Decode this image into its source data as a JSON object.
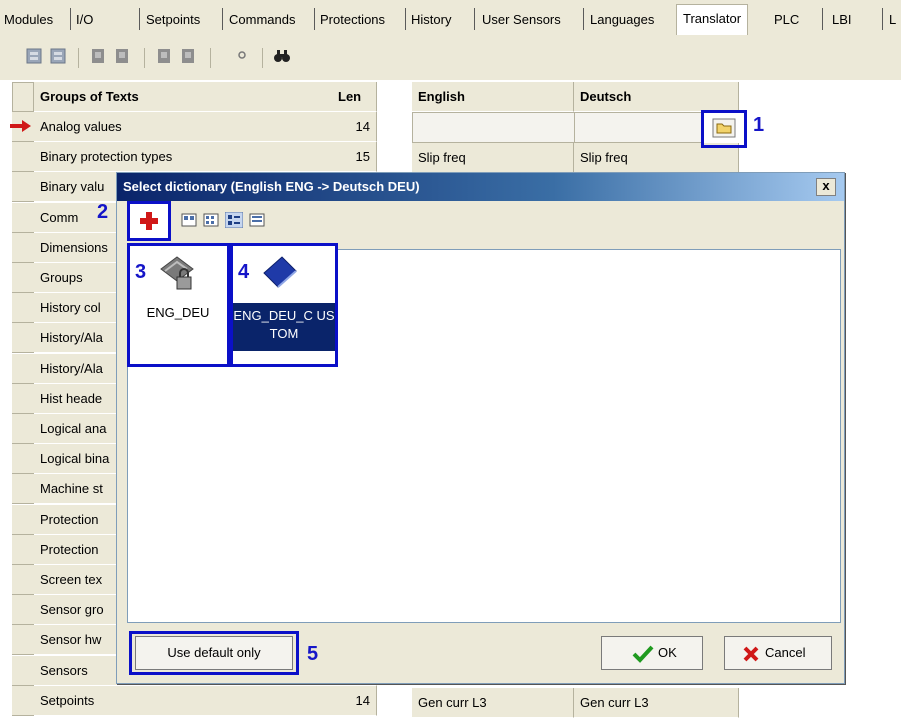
{
  "tabs": [
    {
      "label": "Modules"
    },
    {
      "label": "I/O"
    },
    {
      "label": "Setpoints"
    },
    {
      "label": "Commands"
    },
    {
      "label": "Protections"
    },
    {
      "label": "History"
    },
    {
      "label": "User Sensors"
    },
    {
      "label": "Languages"
    },
    {
      "label": "Translator"
    },
    {
      "label": "PLC"
    },
    {
      "label": "LBI"
    },
    {
      "label": "L"
    }
  ],
  "active_tab": "Translator",
  "groups_table": {
    "header_name": "Groups of Texts",
    "header_len": "Len",
    "rows": [
      {
        "name": "Analog values",
        "len": "14"
      },
      {
        "name": "Binary protection types",
        "len": "15"
      },
      {
        "name": "Binary valu",
        "len": ""
      },
      {
        "name": "Comm",
        "len": ""
      },
      {
        "name": "Dimensions",
        "len": ""
      },
      {
        "name": "Groups",
        "len": ""
      },
      {
        "name": "History col",
        "len": ""
      },
      {
        "name": "History/Ala",
        "len": ""
      },
      {
        "name": "History/Ala",
        "len": ""
      },
      {
        "name": "Hist heade",
        "len": ""
      },
      {
        "name": "Logical ana",
        "len": ""
      },
      {
        "name": "Logical bina",
        "len": ""
      },
      {
        "name": "Machine st",
        "len": ""
      },
      {
        "name": "Protection",
        "len": ""
      },
      {
        "name": "Protection",
        "len": ""
      },
      {
        "name": "Screen tex",
        "len": ""
      },
      {
        "name": "Sensor gro",
        "len": ""
      },
      {
        "name": "Sensor hw",
        "len": ""
      },
      {
        "name": "Sensors",
        "len": ""
      },
      {
        "name": "Setpoints",
        "len": "14"
      }
    ]
  },
  "translation_table": {
    "col1": "English",
    "col2": "Deutsch",
    "rows": [
      {
        "en": "Slip freq",
        "de": "Slip freq"
      },
      {
        "en": "Gen curr L3",
        "de": "Gen curr L3"
      }
    ]
  },
  "dialog": {
    "title": "Select dictionary (English ENG -> Deutsch DEU)",
    "close": "x",
    "items": [
      {
        "label": "ENG_DEU",
        "icon": "locked-dictionary-icon"
      },
      {
        "label": "ENG_DEU_C USTOM",
        "icon": "dictionary-book-icon"
      }
    ],
    "use_default_label": "Use default only",
    "ok_label": "OK",
    "cancel_label": "Cancel"
  },
  "callouts": {
    "c1": "1",
    "c2": "2",
    "c3": "3",
    "c4": "4",
    "c5": "5"
  },
  "colors": {
    "accent_blue": "#0b10c8",
    "selection": "#0a246a",
    "dialog_bg": "#ece9d8"
  }
}
